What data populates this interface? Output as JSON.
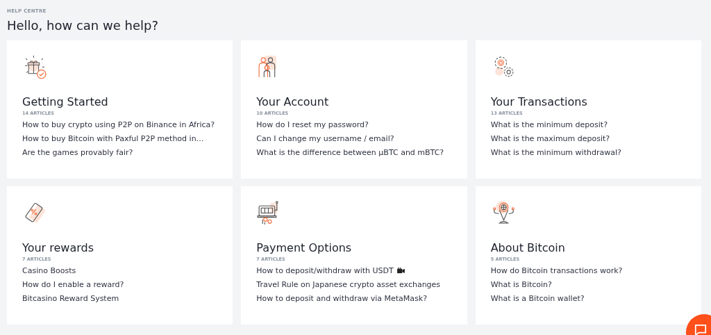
{
  "eyebrow": "HELP CENTRE",
  "heading": "Hello, how can we help?",
  "categories": [
    {
      "title": "Getting Started",
      "count": "14 ARTICLES",
      "articles": [
        {
          "text": "How to buy crypto using P2P on Binance in Africa?"
        },
        {
          "text": "How to buy Bitcoin with Paxful P2P method in…"
        },
        {
          "text": "Are the games provably fair?"
        }
      ]
    },
    {
      "title": "Your Account",
      "count": "10 ARTICLES",
      "articles": [
        {
          "text": "How do I reset my password?"
        },
        {
          "text": "Can I change my username / email?"
        },
        {
          "text": "What is the difference between µBTC and mBTC?"
        }
      ]
    },
    {
      "title": "Your Transactions",
      "count": "13 ARTICLES",
      "articles": [
        {
          "text": "What is the minimum deposit?"
        },
        {
          "text": "What is the maximum deposit?"
        },
        {
          "text": "What is the minimum withdrawal?"
        }
      ]
    },
    {
      "title": "Your rewards",
      "count": "7 ARTICLES",
      "articles": [
        {
          "text": "Casino Boosts"
        },
        {
          "text": "How do I enable a reward?"
        },
        {
          "text": "Bitcasino Reward System"
        }
      ]
    },
    {
      "title": "Payment Options",
      "count": "7 ARTICLES",
      "articles": [
        {
          "text": "How to deposit/withdraw with USDT",
          "video": true
        },
        {
          "text": "Travel Rule on Japanese crypto asset exchanges"
        },
        {
          "text": "How to deposit and withdraw via MetaMask?"
        }
      ]
    },
    {
      "title": "About Bitcoin",
      "count": "5 ARTICLES",
      "articles": [
        {
          "text": "How do Bitcoin transactions work?"
        },
        {
          "text": "What is Bitcoin?"
        },
        {
          "text": "What is a Bitcoin wallet?"
        }
      ]
    }
  ]
}
